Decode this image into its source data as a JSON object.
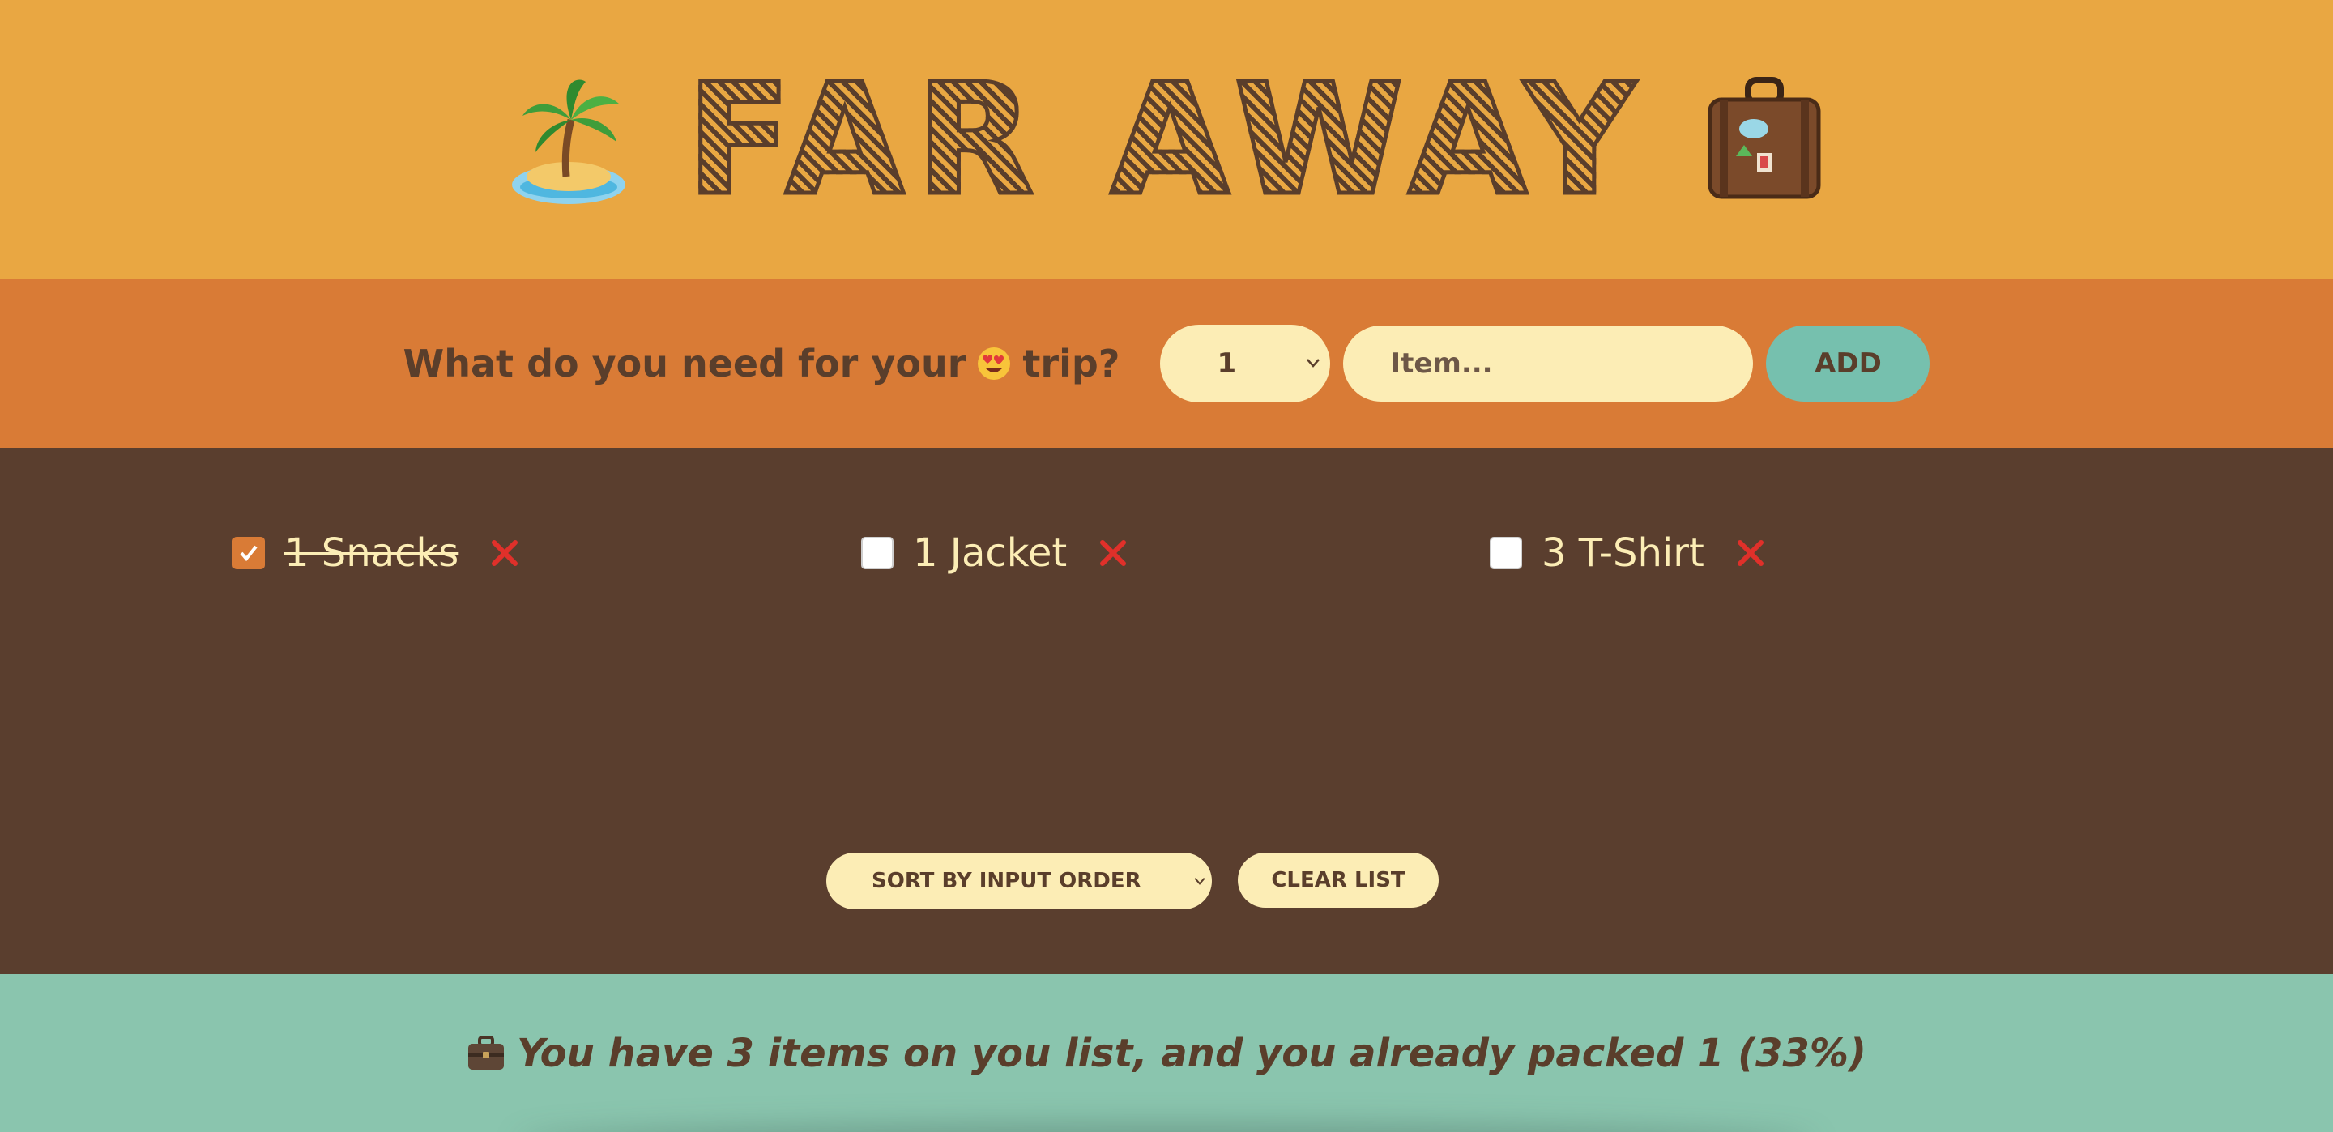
{
  "header": {
    "title": "FAR AWAY",
    "left_icon": "palm-island-icon",
    "right_icon": "suitcase-icon"
  },
  "form": {
    "question_before": "What do you need for your",
    "question_after": "trip?",
    "question_emoji": "heart-eyes-emoji-icon",
    "quantity_value": "1",
    "item_placeholder": "Item...",
    "add_label": "ADD"
  },
  "list": {
    "items": [
      {
        "label": "1 Snacks",
        "packed": true
      },
      {
        "label": "1 Jacket",
        "packed": false
      },
      {
        "label": "3 T-Shirt",
        "packed": false
      }
    ],
    "sort_value": "SORT BY INPUT ORDER",
    "clear_label": "CLEAR LIST"
  },
  "stats": {
    "text": "You have 3 items on you list, and you already packed 1 (33%)",
    "icon": "briefcase-icon"
  },
  "colors": {
    "header_bg": "#e9a742",
    "form_bg": "#d97b36",
    "list_bg": "#5a3e2e",
    "stats_bg": "#8ac5ae",
    "accent_text": "#5a3e2b",
    "cream": "#fcedb5",
    "delete_red": "#e0302a",
    "add_button": "#76c0ae"
  }
}
